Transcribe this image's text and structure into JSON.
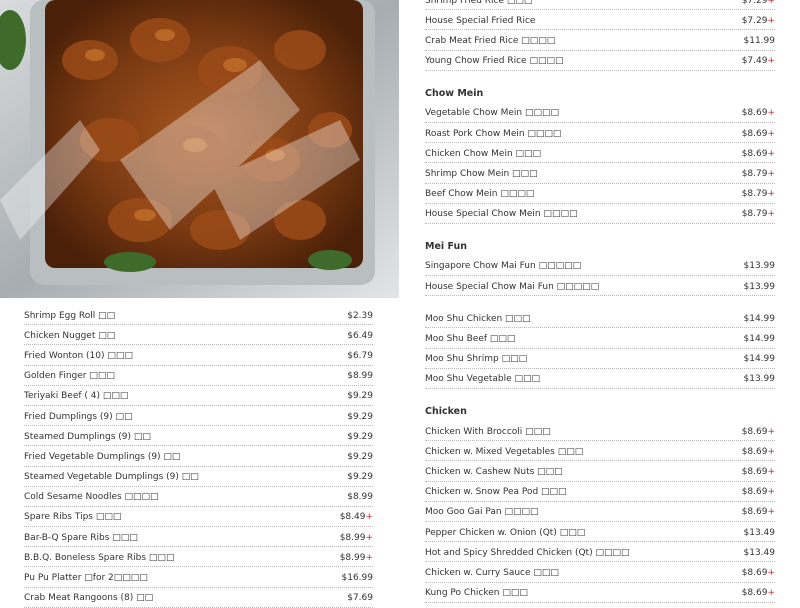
{
  "photo_alt": "Orange chicken in a foil tray with plastic wrap",
  "left_items": [
    {
      "name": "Shrimp Egg Roll □□",
      "price": "$2.39",
      "plus": ""
    },
    {
      "name": "Chicken Nugget □□",
      "price": "$6.49",
      "plus": ""
    },
    {
      "name": "Fried Wonton (10) □□□",
      "price": "$6.79",
      "plus": ""
    },
    {
      "name": "Golden Finger □□□",
      "price": "$8.99",
      "plus": ""
    },
    {
      "name": "Teriyaki Beef ( 4) □□□",
      "price": "$9.29",
      "plus": ""
    },
    {
      "name": "Fried Dumplings (9) □□",
      "price": "$9.29",
      "plus": ""
    },
    {
      "name": "Steamed Dumplings (9) □□",
      "price": "$9.29",
      "plus": ""
    },
    {
      "name": "Fried Vegetable Dumplings (9) □□",
      "price": "$9.29",
      "plus": ""
    },
    {
      "name": "Steamed Vegetable Dumplings (9) □□",
      "price": "$9.29",
      "plus": ""
    },
    {
      "name": "Cold Sesame Noodles □□□□",
      "price": "$8.99",
      "plus": ""
    },
    {
      "name": "Spare Ribs Tips □□□",
      "price": "$8.49",
      "plus": "+"
    },
    {
      "name": "Bar-B-Q Spare Ribs □□□",
      "price": "$8.99",
      "plus": "+"
    },
    {
      "name": "B.B.Q. Boneless Spare Ribs □□□",
      "price": "$8.99",
      "plus": "+"
    },
    {
      "name": "Pu Pu Platter □for 2□□□□",
      "price": "$16.99",
      "plus": ""
    },
    {
      "name": "Crab Meat Rangoons (8) □□",
      "price": "$7.69",
      "plus": ""
    }
  ],
  "right_top_items": [
    {
      "name": "Shrimp Fried Rice □□□",
      "price": "$7.29",
      "plus": "+"
    },
    {
      "name": "House Special Fried Rice",
      "price": "$7.29",
      "plus": "+"
    },
    {
      "name": "Crab Meat Fried Rice □□□□",
      "price": "$11.99",
      "plus": ""
    },
    {
      "name": "Young Chow Fried Rice □□□□",
      "price": "$7.49",
      "plus": "+"
    }
  ],
  "chow_mein": {
    "title": "Chow Mein",
    "items": [
      {
        "name": "Vegetable Chow Mein □□□□",
        "price": "$8.69",
        "plus": "+"
      },
      {
        "name": "Roast Pork Chow Mein □□□□",
        "price": "$8.69",
        "plus": "+"
      },
      {
        "name": "Chicken Chow Mein □□□",
        "price": "$8.69",
        "plus": "+"
      },
      {
        "name": "Shrimp Chow Mein □□□",
        "price": "$8.79",
        "plus": "+"
      },
      {
        "name": "Beef Chow Mein □□□□",
        "price": "$8.79",
        "plus": "+"
      },
      {
        "name": "House Special Chow Mein □□□□",
        "price": "$8.79",
        "plus": "+"
      }
    ]
  },
  "mei_fun": {
    "title": "Mei Fun",
    "items": [
      {
        "name": "Singapore Chow Mai Fun □□□□□",
        "price": "$13.99",
        "plus": ""
      },
      {
        "name": "House Special Chow Mai Fun □□□□□",
        "price": "$13.99",
        "plus": ""
      }
    ]
  },
  "moo_shu_items": [
    {
      "name": "Moo Shu Chicken □□□",
      "price": "$14.99",
      "plus": ""
    },
    {
      "name": "Moo Shu Beef □□□",
      "price": "$14.99",
      "plus": ""
    },
    {
      "name": "Moo Shu Shrimp □□□",
      "price": "$14.99",
      "plus": ""
    },
    {
      "name": "Moo Shu Vegetable □□□",
      "price": "$13.99",
      "plus": ""
    }
  ],
  "chicken": {
    "title": "Chicken",
    "items": [
      {
        "name": "Chicken With Broccoli □□□",
        "price": "$8.69",
        "plus": "+"
      },
      {
        "name": "Chicken w. Mixed Vegetables □□□",
        "price": "$8.69",
        "plus": "+"
      },
      {
        "name": "Chicken w. Cashew Nuts □□□",
        "price": "$8.69",
        "plus": "+"
      },
      {
        "name": "Chicken w. Snow Pea Pod □□□",
        "price": "$8.69",
        "plus": "+"
      },
      {
        "name": "Moo Goo Gai Pan □□□□",
        "price": "$8.69",
        "plus": "+"
      },
      {
        "name": "Pepper Chicken w. Onion (Qt) □□□",
        "price": "$13.49",
        "plus": ""
      },
      {
        "name": "Hot and Spicy Shredded Chicken (Qt) □□□□",
        "price": "$13.49",
        "plus": ""
      },
      {
        "name": "Chicken w. Curry Sauce □□□",
        "price": "$8.69",
        "plus": "+"
      },
      {
        "name": "Kung Po Chicken □□□",
        "price": "$8.69",
        "plus": "+"
      }
    ]
  },
  "colors": {
    "accent_plus": "#dd2222",
    "text": "#333333",
    "divider": "#b8b8b8"
  }
}
